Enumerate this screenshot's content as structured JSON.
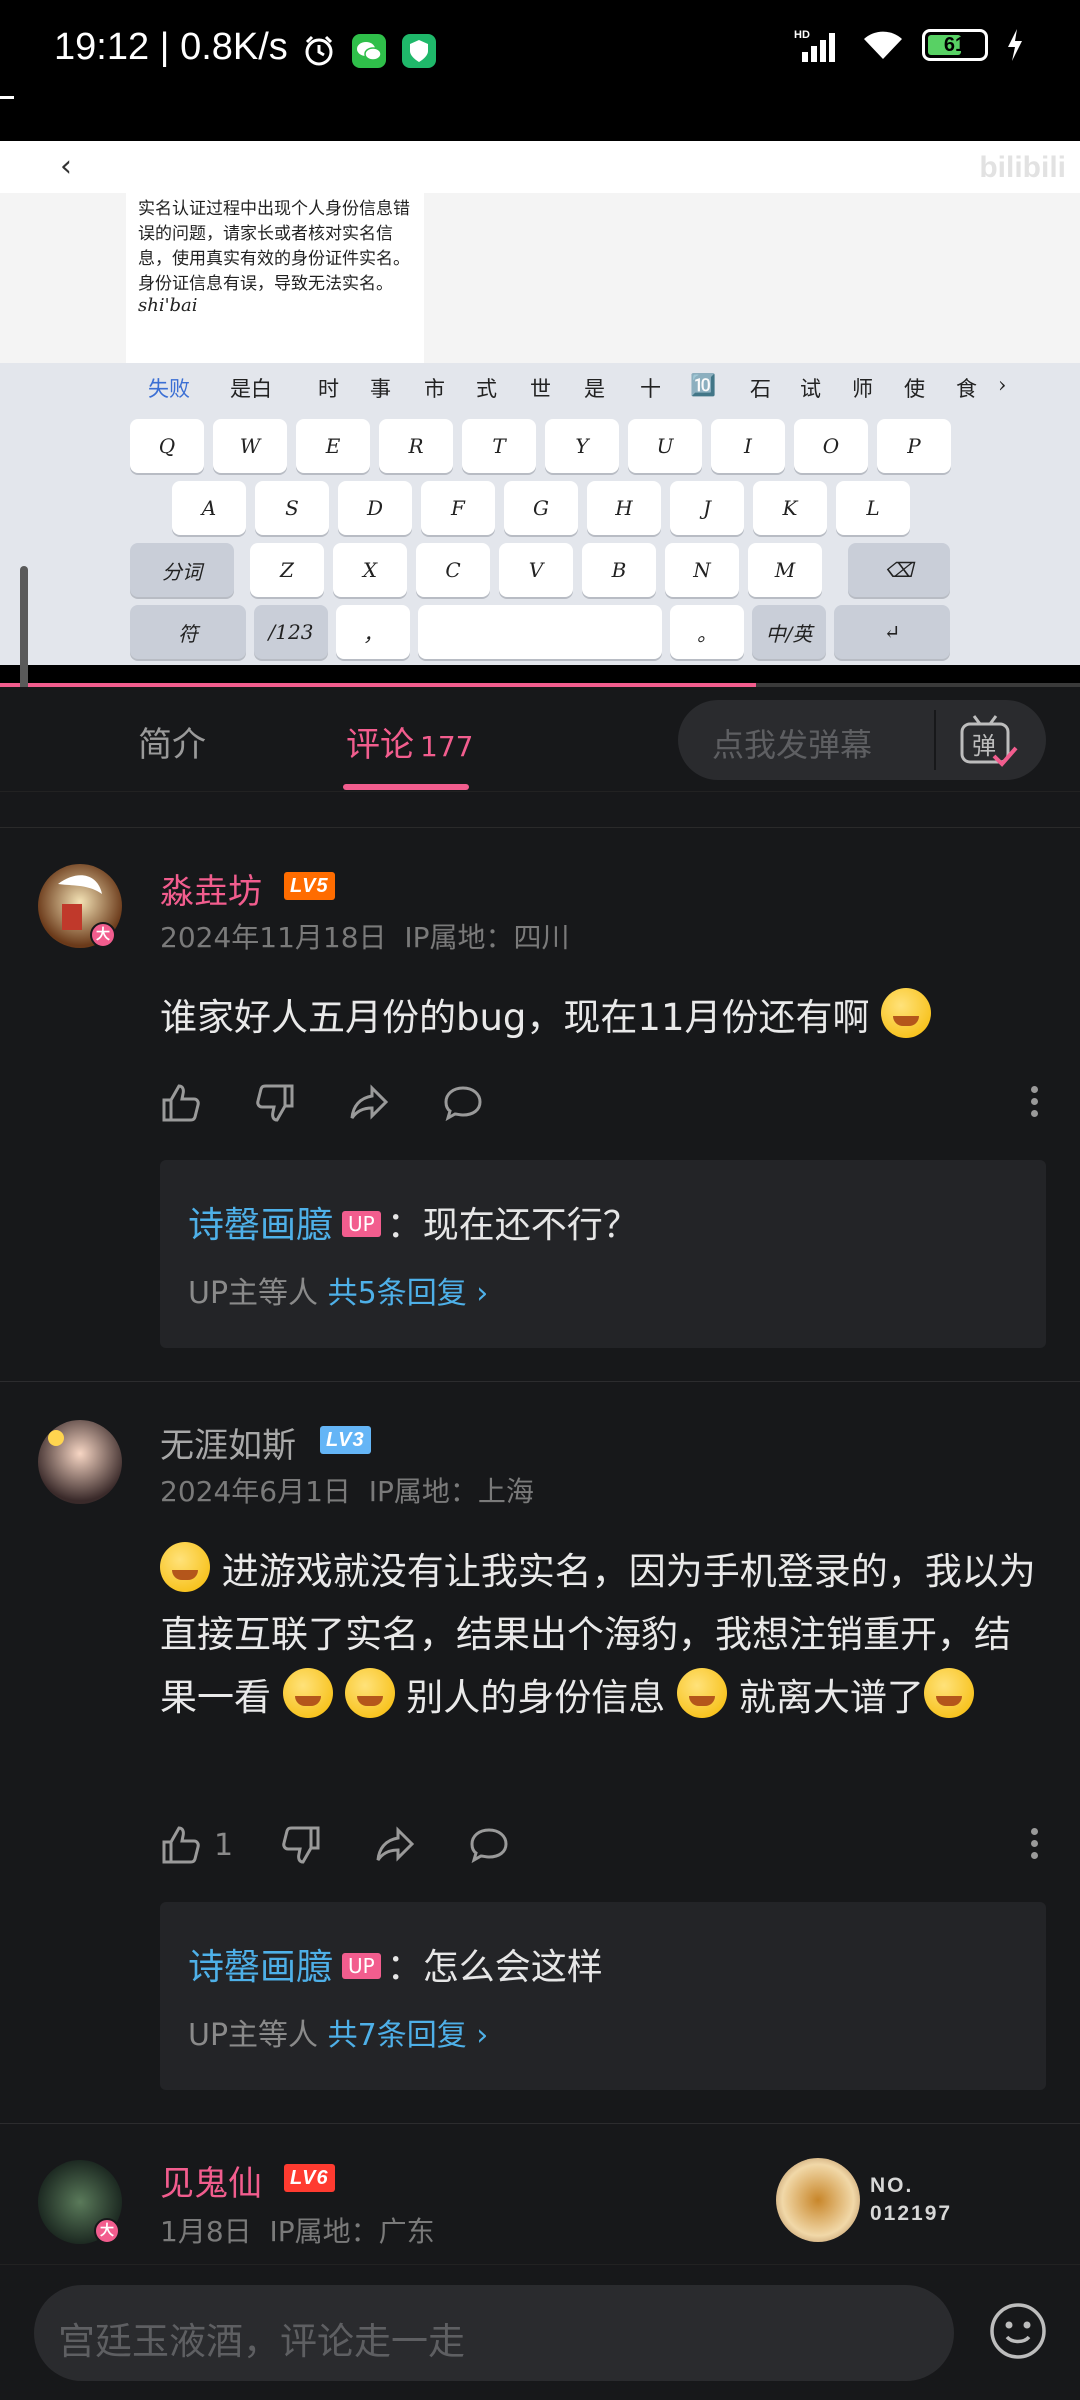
{
  "status_bar": {
    "time": "19:12 | 0.8K/s",
    "network": "HD",
    "battery": "61",
    "battery_fraction": 0.61
  },
  "video": {
    "watermark": "bilibili",
    "document_text": "实名认证过程中出现个人身份信息错误的问题，请家长或者核对实名信息，使用真实有效的身份证件实名。身份证信息有误，导致无法实名。",
    "pinyin": "shi'bai",
    "candidates": [
      "失败",
      "是白",
      "时",
      "事",
      "市",
      "式",
      "世",
      "是",
      "十",
      "🔟",
      "石",
      "试",
      "师",
      "使",
      "食"
    ],
    "keys_row1": [
      "Q",
      "W",
      "E",
      "R",
      "T",
      "Y",
      "U",
      "I",
      "O",
      "P"
    ],
    "keys_row2": [
      "A",
      "S",
      "D",
      "F",
      "G",
      "H",
      "J",
      "K",
      "L"
    ],
    "keys_row3": [
      "分词",
      "Z",
      "X",
      "C",
      "V",
      "B",
      "N",
      "M",
      "⌫"
    ],
    "keys_row4": [
      "符",
      "/123",
      "，",
      "",
      "。",
      "中/英",
      "↵"
    ],
    "progress_fraction": 0.7
  },
  "tabs": {
    "intro": "简介",
    "comments": "评论",
    "comments_count": "177",
    "danmu_placeholder": "点我发弹幕",
    "danmu_icon": "弹"
  },
  "comments": [
    {
      "user": "淼垚坊",
      "level": "LV5",
      "date": "2024年11月18日",
      "ip": "IP属地：四川",
      "text": "谁家好人五月份的bug，现在11月份还有啊",
      "likes": "",
      "reply": {
        "name": "诗罄画臆",
        "tag": "UP",
        "text": "：现在还不行？",
        "by": "UP主等人",
        "count": "共5条回复"
      }
    },
    {
      "user": "无涯如斯",
      "level": "LV3",
      "date": "2024年6月1日",
      "ip": "IP属地：上海",
      "text_parts": [
        "进游戏就没有让我实名，因为手机登录的，我以为直接互联了实名，结果出个海豹，我想注销重开，结果一看",
        "别人的身份信息",
        "就离大谱了"
      ],
      "likes": "1",
      "reply": {
        "name": "诗罄画臆",
        "tag": "UP",
        "text": "：怎么会这样",
        "by": "UP主等人",
        "count": "共7条回复"
      }
    },
    {
      "user": "见鬼仙",
      "level": "LV6",
      "date": "1月8日",
      "ip": "IP属地：广东",
      "badge_no": "NO.\n012197"
    }
  ],
  "bottom": {
    "placeholder": "宫廷玉液酒，评论走一走"
  },
  "colors": {
    "accent": "#f25d8e",
    "link": "#4eb0e8",
    "background": "#17181a"
  }
}
